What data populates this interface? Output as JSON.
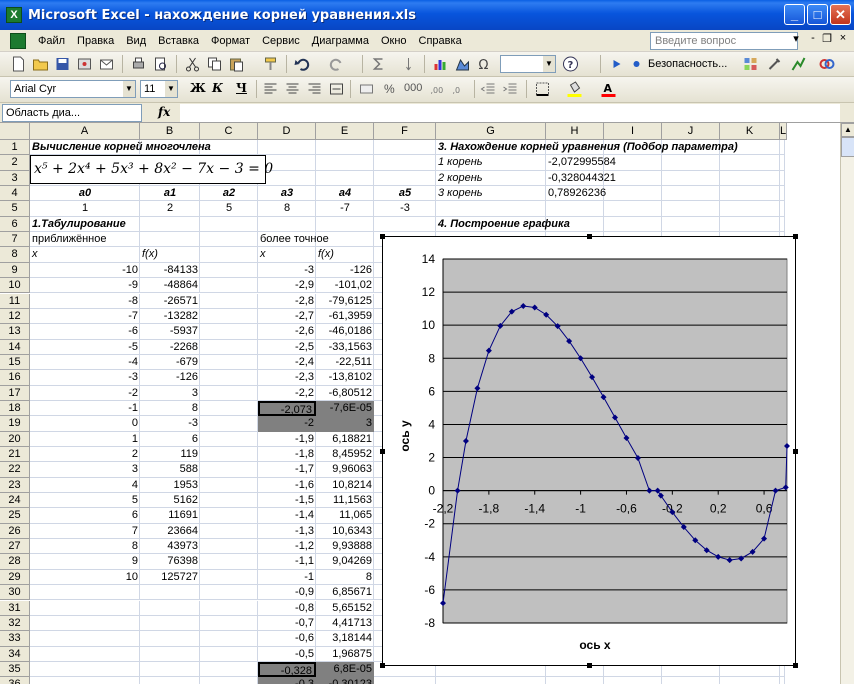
{
  "window": {
    "title": "Microsoft Excel - нахождение корней уравнения.xls",
    "min_glyph": "_",
    "max_glyph": "□",
    "close_glyph": "✕"
  },
  "menu": {
    "items": [
      "Файл",
      "Правка",
      "Вид",
      "Вставка",
      "Формат",
      "Сервис",
      "Диаграмма",
      "Окно",
      "Справка"
    ],
    "help_placeholder": "Введите вопрос",
    "help_arrow": "▾",
    "ctl_minimize": "-",
    "ctl_restore": "❐",
    "ctl_close": "×"
  },
  "toolbar_standard": {
    "security_label": "Безопасность..."
  },
  "toolbar_format": {
    "font_name": "Arial Cyr",
    "font_size": "11",
    "bold": "Ж",
    "italic": "К",
    "underline": "Ч"
  },
  "formula_bar": {
    "name_box": "Область диа...",
    "fx_label": "fx",
    "formula": ""
  },
  "sheet": {
    "columns": [
      "A",
      "B",
      "C",
      "D",
      "E",
      "F",
      "G",
      "H",
      "I",
      "J",
      "K",
      "L"
    ],
    "rows": [
      "1",
      "2",
      "3",
      "4",
      "5",
      "6",
      "7",
      "8",
      "9",
      "10",
      "11",
      "12",
      "13",
      "14",
      "15",
      "16",
      "17",
      "18",
      "19",
      "20",
      "21",
      "22",
      "23",
      "24",
      "25",
      "26",
      "27",
      "28",
      "29",
      "30",
      "31",
      "32",
      "33",
      "34",
      "35",
      "36"
    ],
    "title_1": "Вычисление корней многочлена",
    "equation": "x⁵ + 2x⁴ + 5x³ + 8x² − 7x − 3 = 0",
    "coef_labels": [
      "a0",
      "a1",
      "a2",
      "a3",
      "a4",
      "a5"
    ],
    "coef_values": [
      "1",
      "2",
      "5",
      "8",
      "-7",
      "-3"
    ],
    "section_1": "1.Табулирование",
    "approx_label": "приближённое",
    "precise_label": "более точное",
    "x_header": "x",
    "fx_header": "f(x)",
    "section_3": "3. Нахождение корней уравнения (Подбор параметра)",
    "roots": [
      {
        "label": "1 корень",
        "value": "-2,072995584"
      },
      {
        "label": "2 корень",
        "value": "-0,328044321"
      },
      {
        "label": "3 корень",
        "value": "0,78926236"
      }
    ],
    "section_4": "4. Построение графика",
    "coarse_table": [
      [
        "-10",
        "-84133"
      ],
      [
        "-9",
        "-48864"
      ],
      [
        "-8",
        "-26571"
      ],
      [
        "-7",
        "-13282"
      ],
      [
        "-6",
        "-5937"
      ],
      [
        "-5",
        "-2268"
      ],
      [
        "-4",
        "-679"
      ],
      [
        "-3",
        "-126"
      ],
      [
        "-2",
        "3"
      ],
      [
        "-1",
        "8"
      ],
      [
        "0",
        "-3"
      ],
      [
        "1",
        "6"
      ],
      [
        "2",
        "119"
      ],
      [
        "3",
        "588"
      ],
      [
        "4",
        "1953"
      ],
      [
        "5",
        "5162"
      ],
      [
        "6",
        "11691"
      ],
      [
        "7",
        "23664"
      ],
      [
        "8",
        "43973"
      ],
      [
        "9",
        "76398"
      ],
      [
        "10",
        "125727"
      ]
    ],
    "fine_table": [
      [
        "-3",
        "-126"
      ],
      [
        "-2,9",
        "-101,02"
      ],
      [
        "-2,8",
        "-79,6125"
      ],
      [
        "-2,7",
        "-61,3959"
      ],
      [
        "-2,6",
        "-46,0186"
      ],
      [
        "-2,5",
        "-33,1563"
      ],
      [
        "-2,4",
        "-22,511"
      ],
      [
        "-2,3",
        "-13,8102"
      ],
      [
        "-2,2",
        "-6,80512"
      ],
      [
        "-2,073",
        "-7,6E-05"
      ],
      [
        "-2",
        "3"
      ],
      [
        "-1,9",
        "6,18821"
      ],
      [
        "-1,8",
        "8,45952"
      ],
      [
        "-1,7",
        "9,96063"
      ],
      [
        "-1,6",
        "10,8214"
      ],
      [
        "-1,5",
        "11,1563"
      ],
      [
        "-1,4",
        "11,065"
      ],
      [
        "-1,3",
        "10,6343"
      ],
      [
        "-1,2",
        "9,93888"
      ],
      [
        "-1,1",
        "9,04269"
      ],
      [
        "-1",
        "8"
      ],
      [
        "-0,9",
        "6,85671"
      ],
      [
        "-0,8",
        "5,65152"
      ],
      [
        "-0,7",
        "4,41713"
      ],
      [
        "-0,6",
        "3,18144"
      ],
      [
        "-0,5",
        "1,96875"
      ],
      [
        "-0,328",
        "6,8E-05"
      ],
      [
        "-0,3",
        "-0,30123"
      ]
    ]
  },
  "chart_data": {
    "type": "scatter",
    "title": "",
    "xlabel": "ось x",
    "ylabel": "ось y",
    "xlim": [
      -2.2,
      0.8
    ],
    "ylim": [
      -8,
      14
    ],
    "x_ticks": [
      "-2,2",
      "-1,8",
      "-1,4",
      "-1",
      "-0,6",
      "-0,2",
      "0,2",
      "0,6"
    ],
    "y_ticks": [
      "-8",
      "-6",
      "-4",
      "-2",
      "0",
      "2",
      "4",
      "6",
      "8",
      "10",
      "12",
      "14"
    ],
    "plot_color": "#c0c0c0",
    "line_color": "#000080",
    "series": [
      {
        "x": [
          -2.2,
          -2.073,
          -2.0,
          -1.9,
          -1.8,
          -1.7,
          -1.6,
          -1.5,
          -1.4,
          -1.3,
          -1.2,
          -1.1,
          -1.0,
          -0.9,
          -0.8,
          -0.7,
          -0.6,
          -0.5,
          -0.4,
          -0.328,
          -0.3,
          -0.2,
          -0.1,
          0.0,
          0.1,
          0.2,
          0.3,
          0.4,
          0.5,
          0.6,
          0.7,
          0.789,
          0.8
        ],
        "y": [
          -6.8,
          0.0,
          3.0,
          6.19,
          8.46,
          9.96,
          10.82,
          11.16,
          11.07,
          10.63,
          9.94,
          9.04,
          8.0,
          6.86,
          5.65,
          4.42,
          3.18,
          1.97,
          0.0,
          0.0,
          -0.3,
          -1.3,
          -2.2,
          -3.0,
          -3.6,
          -4.0,
          -4.2,
          -4.1,
          -3.7,
          -2.9,
          0.0,
          0.2,
          2.7
        ]
      }
    ]
  }
}
